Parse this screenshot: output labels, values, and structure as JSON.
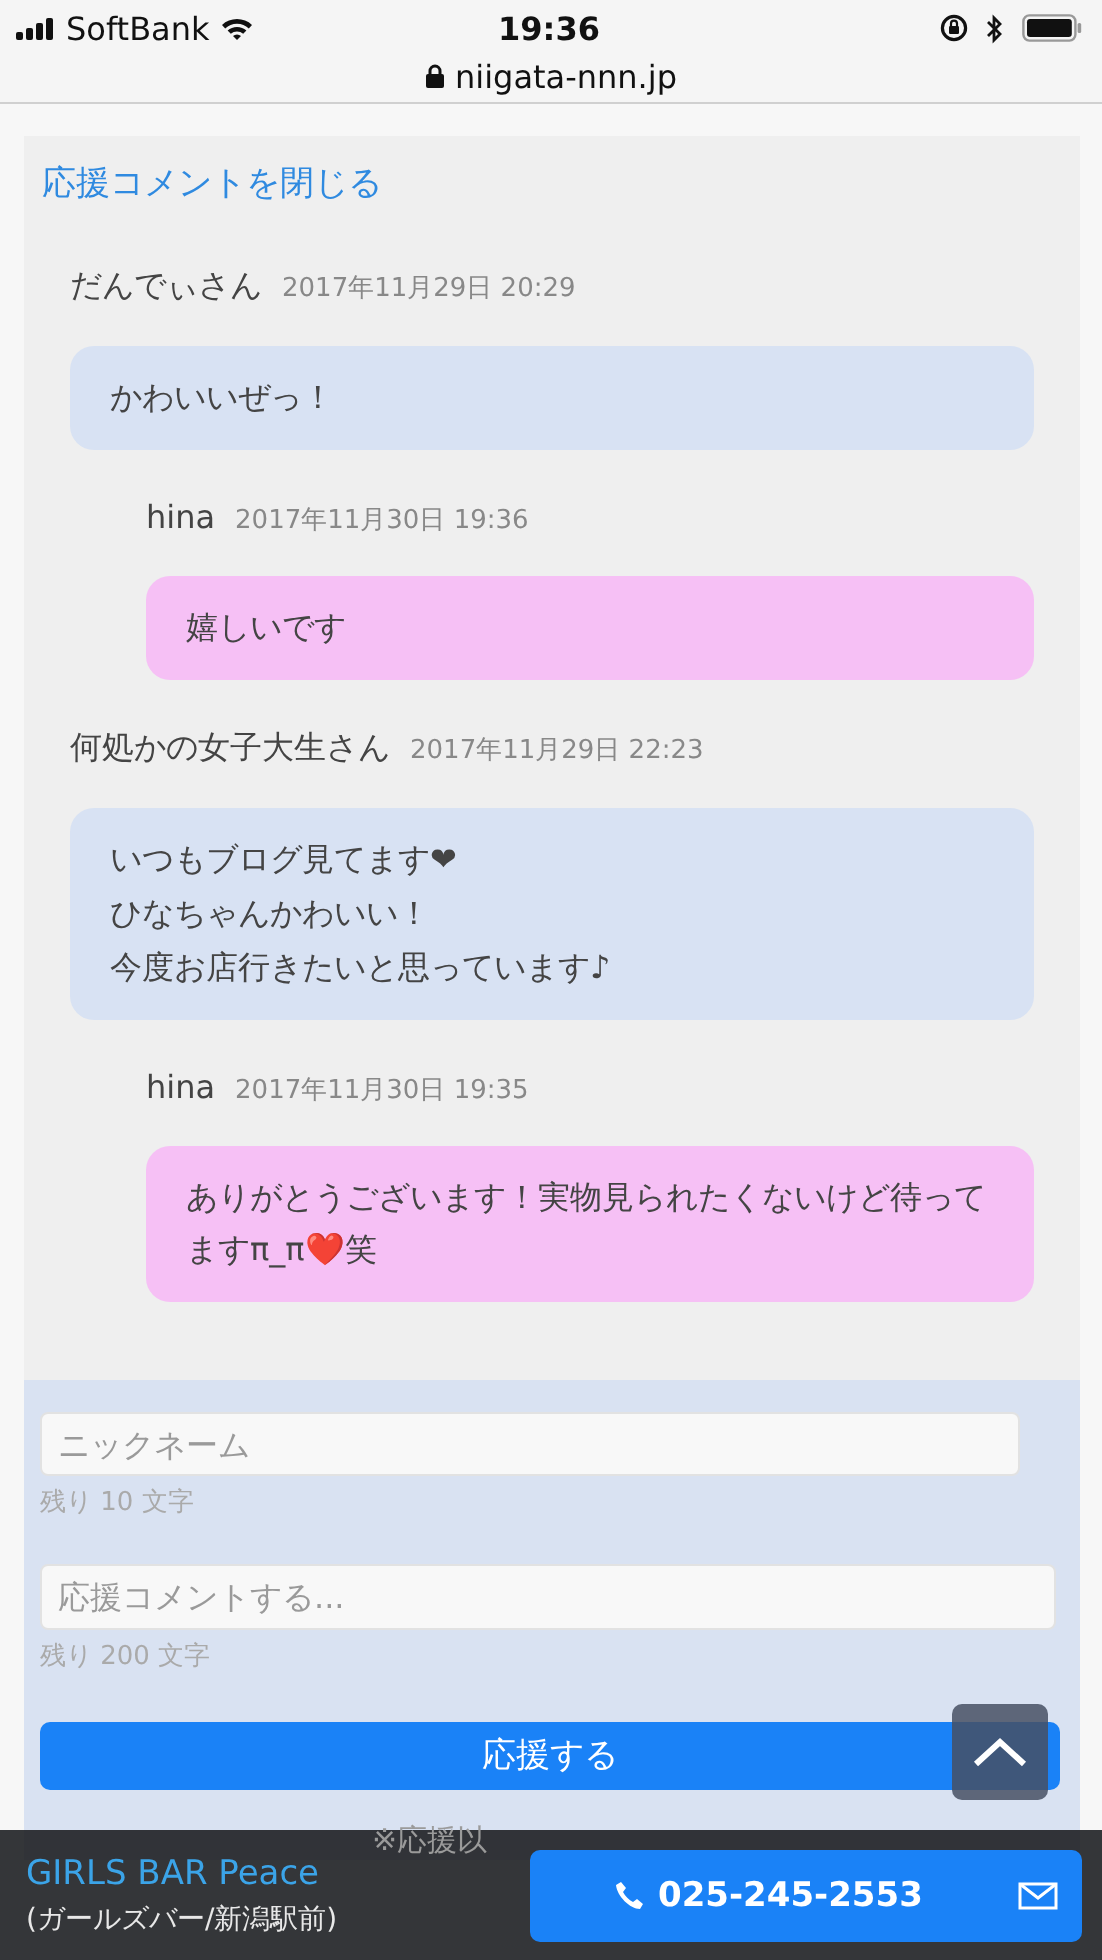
{
  "status_bar": {
    "carrier": "SoftBank",
    "time": "19:36",
    "url": "niigata-nnn.jp"
  },
  "close_link": "応援コメントを閉じる",
  "comments": [
    {
      "kind": "comment",
      "author": "だんでぃさん",
      "date": "2017年11月29日 20:29",
      "lines": [
        "かわいいぜっ！"
      ]
    },
    {
      "kind": "reply",
      "author": "hina",
      "date": "2017年11月30日 19:36",
      "lines": [
        "嬉しいです"
      ]
    },
    {
      "kind": "comment",
      "author": "何処かの女子大生さん",
      "date": "2017年11月29日 22:23",
      "lines": [
        "いつもブログ見てます❤",
        "ひなちゃんかわいい！",
        "今度お店行きたいと思っています♪"
      ]
    },
    {
      "kind": "reply",
      "author": "hina",
      "date": "2017年11月30日 19:35",
      "lines": [
        "ありがとうございます！実物見られたくないけど待ってますπ_π❤️笑"
      ]
    }
  ],
  "form": {
    "nickname": {
      "placeholder": "ニックネーム",
      "counter": "残り 10 文字"
    },
    "comment": {
      "placeholder": "応援コメントする...",
      "counter": "残り 200 文字"
    },
    "submit": "応援する",
    "note": "※応援以"
  },
  "footer": {
    "shop_name": "GIRLS BAR Peace",
    "shop_sub": "(ガールズバー/新潟駅前)",
    "phone": "025-245-2553"
  }
}
